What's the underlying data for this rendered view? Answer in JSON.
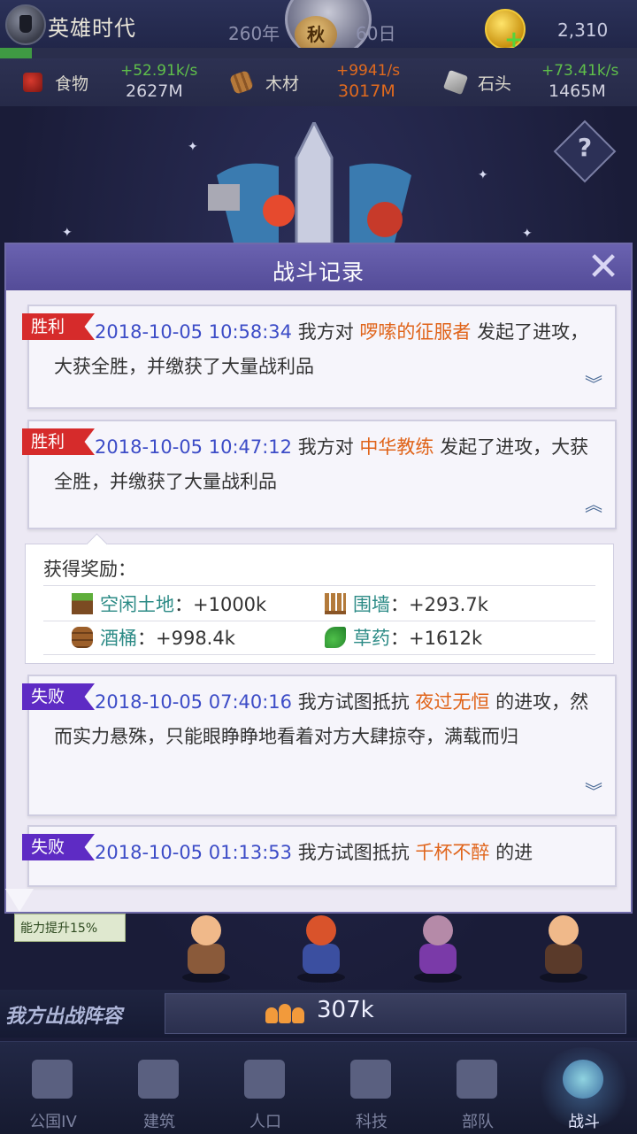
{
  "header": {
    "game_title": "英雄时代",
    "year": "260年",
    "season": "秋",
    "day": "60日",
    "coins": "2,310",
    "progress": 0.05
  },
  "resources": [
    {
      "label": "食物",
      "rate": "+52.91k/s",
      "amount": "2627M",
      "rate_color": "#5fbf4a",
      "amount_color": "#d3d3e0"
    },
    {
      "label": "木材",
      "rate": "+9941/s",
      "amount": "3017M",
      "rate_color": "#e06a1e",
      "amount_color": "#e06a1e"
    },
    {
      "label": "石头",
      "rate": "+73.41k/s",
      "amount": "1465M",
      "rate_color": "#5fbf4a",
      "amount_color": "#d3d3e0"
    }
  ],
  "modal": {
    "title": "战斗记录",
    "entries": [
      {
        "tag": "胜利",
        "time": "2018-10-05 10:58:34",
        "pre": "我方对",
        "opponent": "啰嗦的征服者",
        "post": "发起了进攻，大获全胜，并缴获了大量战利品",
        "chevron": "︾"
      },
      {
        "tag": "胜利",
        "time": "2018-10-05 10:47:12",
        "pre": "我方对",
        "opponent": "中华教练",
        "post": "发起了进攻，大获全胜，并缴获了大量战利品",
        "chevron": "︽"
      },
      {
        "tag": "失败",
        "time": "2018-10-05 07:40:16",
        "pre": "我方试图抵抗",
        "opponent": "夜过无恒",
        "post": "的进攻，然而实力悬殊，只能眼睁睁地看着对方大肆掠夺，满载而归",
        "chevron": "︾"
      },
      {
        "tag": "失败",
        "time": "2018-10-05 01:13:53",
        "pre": "我方试图抵抗",
        "opponent": "千杯不醉",
        "post": "的进"
      }
    ],
    "reward": {
      "title": "获得奖励：",
      "items": [
        {
          "name": "空闲土地",
          "value": "：+1000k",
          "icon": "land-icon"
        },
        {
          "name": "围墙",
          "value": "：+293.7k",
          "icon": "fence-icon"
        },
        {
          "name": "酒桶",
          "value": "：+998.4k",
          "icon": "barrel-icon"
        },
        {
          "name": "草药",
          "value": "：+1612k",
          "icon": "herb-icon"
        }
      ]
    }
  },
  "boost_text": "能力提升15%",
  "lineup": {
    "label": "我方出战阵容",
    "power": "307k"
  },
  "nav": [
    {
      "label": "公国IV",
      "icon": "castle-icon"
    },
    {
      "label": "建筑",
      "icon": "house-icon"
    },
    {
      "label": "人口",
      "icon": "person-icon"
    },
    {
      "label": "科技",
      "icon": "book-icon"
    },
    {
      "label": "部队",
      "icon": "banner-icon"
    },
    {
      "label": "战斗",
      "icon": "swords-icon",
      "active": true
    }
  ]
}
